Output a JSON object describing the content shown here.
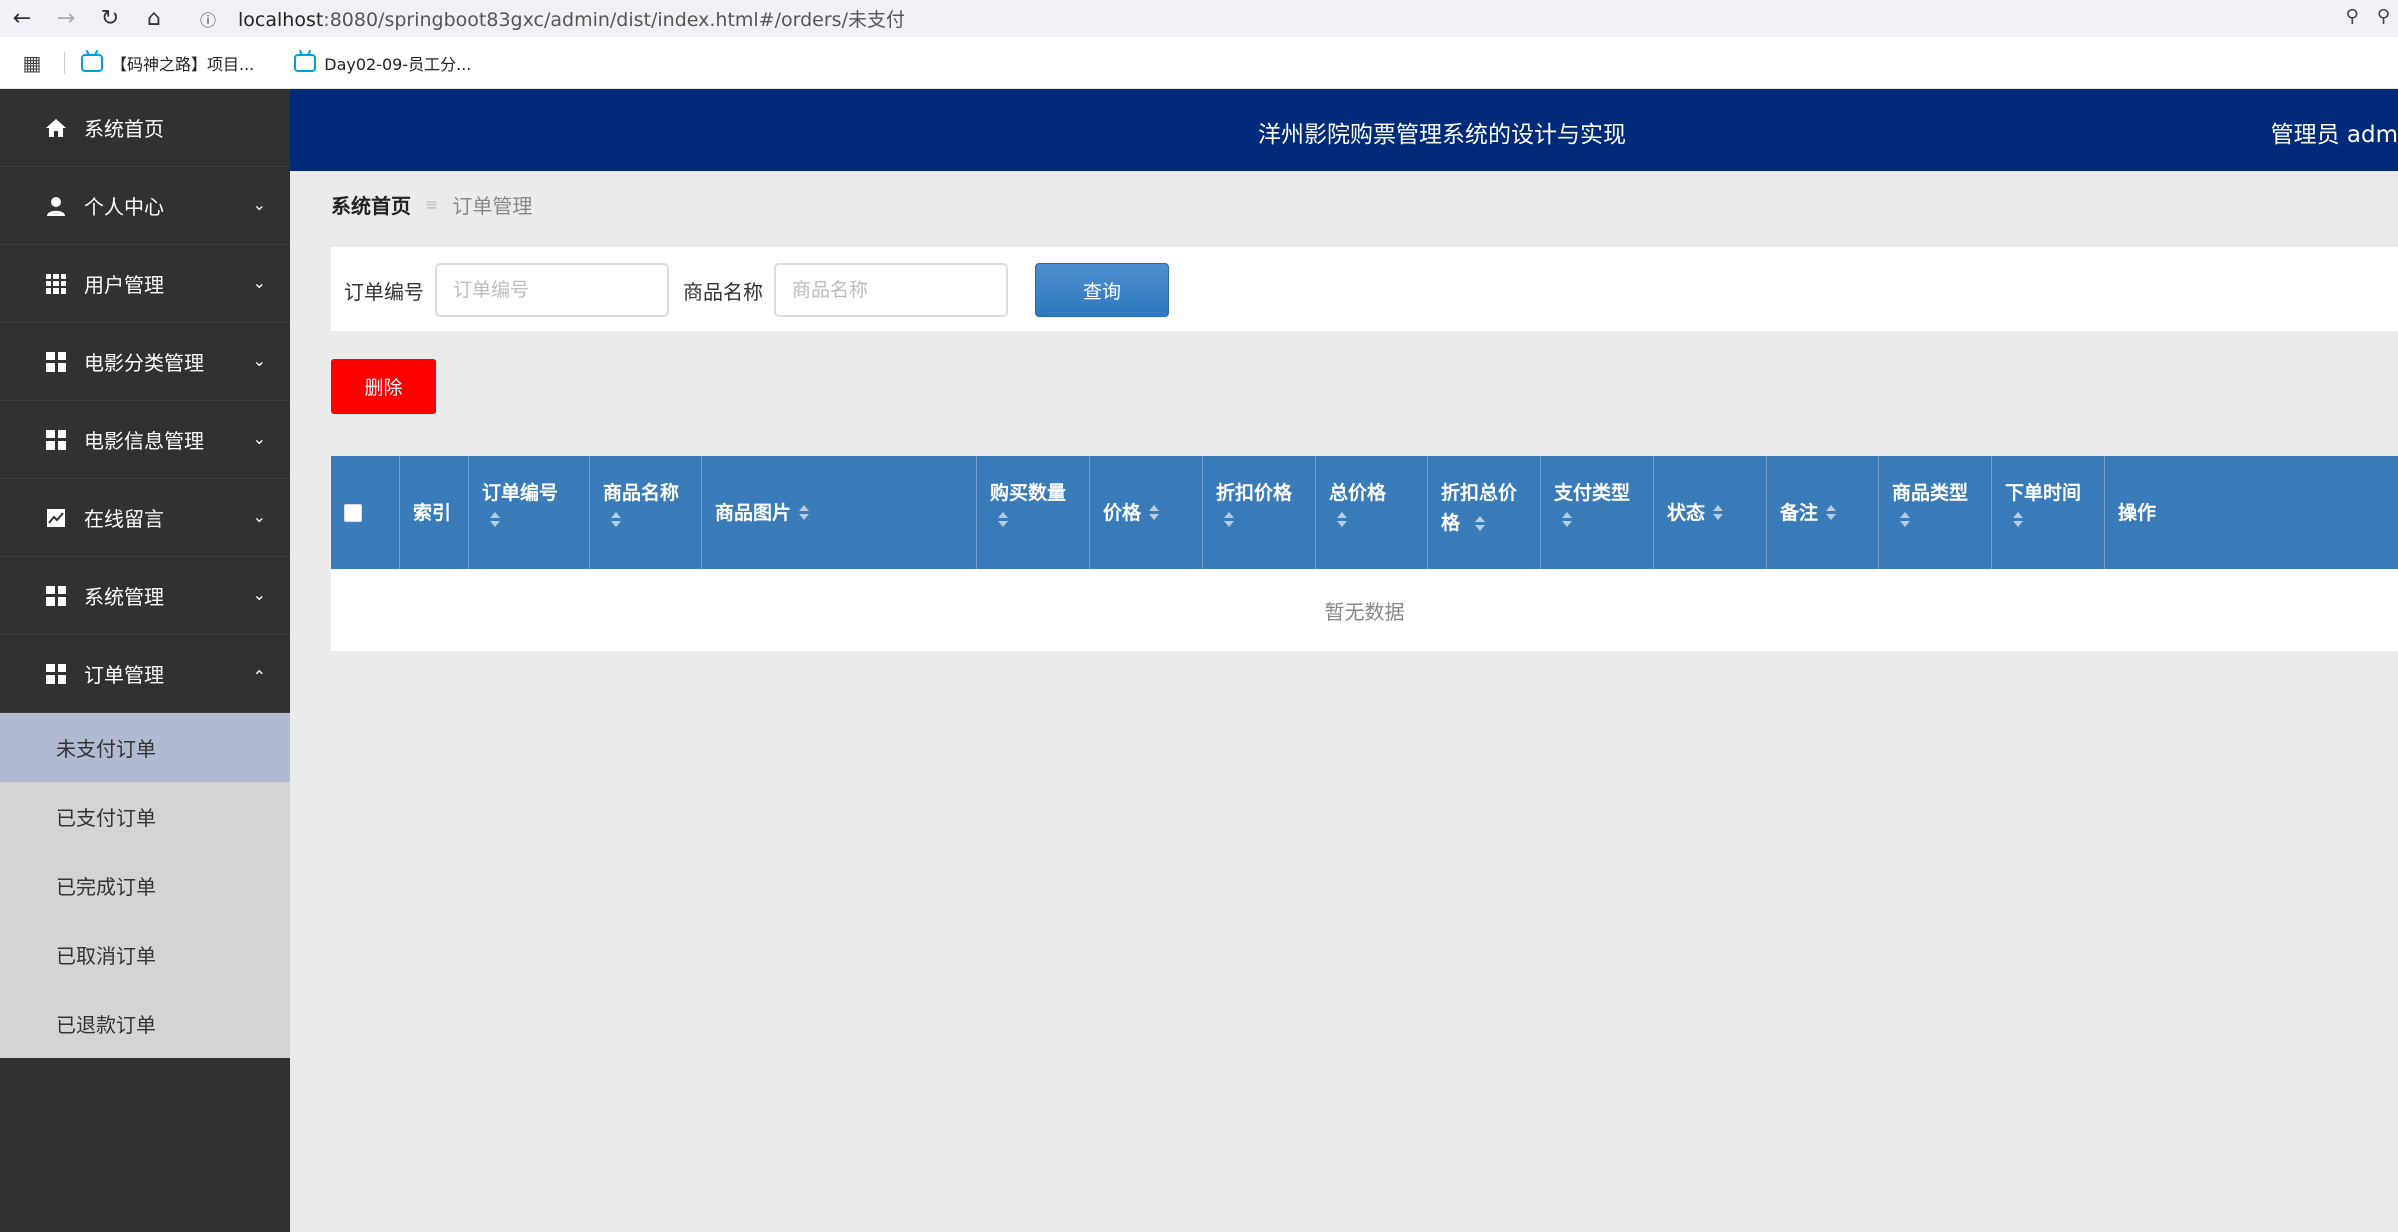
{
  "browser": {
    "url_host": "localhost",
    "url_path": ":8080/springboot83gxc/admin/dist/index.html#/orders/未支付",
    "bookmarks": [
      "【码神之路】项目...",
      "Day02-09-员工分..."
    ]
  },
  "sidebar": {
    "items": [
      {
        "label": "系统首页",
        "icon": "home-icon"
      },
      {
        "label": "个人中心",
        "icon": "user-icon"
      },
      {
        "label": "用户管理",
        "icon": "grid9-icon"
      },
      {
        "label": "电影分类管理",
        "icon": "grid-icon"
      },
      {
        "label": "电影信息管理",
        "icon": "grid-icon"
      },
      {
        "label": "在线留言",
        "icon": "chart-icon"
      },
      {
        "label": "系统管理",
        "icon": "grid-icon"
      },
      {
        "label": "订单管理",
        "icon": "grid-icon"
      }
    ],
    "submenu": [
      "未支付订单",
      "已支付订单",
      "已完成订单",
      "已取消订单",
      "已退款订单"
    ],
    "active_sub": "未支付订单"
  },
  "header": {
    "title": "洋州影院购票管理系统的设计与实现",
    "user": "管理员 adm"
  },
  "breadcrumb": {
    "home": "系统首页",
    "current": "订单管理"
  },
  "search": {
    "order_no_label": "订单编号",
    "order_no_placeholder": "订单编号",
    "goods_name_label": "商品名称",
    "goods_name_placeholder": "商品名称",
    "query_label": "查询"
  },
  "actions": {
    "delete_label": "删除"
  },
  "table": {
    "columns": [
      {
        "line1": "索引",
        "line2": ""
      },
      {
        "line1": "订单编号",
        "line2": ""
      },
      {
        "line1": "商品名称",
        "line2": ""
      },
      {
        "line1": "商品图片",
        "line2": ""
      },
      {
        "line1": "购买数量",
        "line2": ""
      },
      {
        "line1": "价格",
        "line2": ""
      },
      {
        "line1": "折扣价格",
        "line2": ""
      },
      {
        "line1": "总价格",
        "line2": ""
      },
      {
        "line1": "折扣总价",
        "line2": "格"
      },
      {
        "line1": "支付类型",
        "line2": ""
      },
      {
        "line1": "状态",
        "line2": ""
      },
      {
        "line1": "备注",
        "line2": ""
      },
      {
        "line1": "商品类型",
        "line2": ""
      },
      {
        "line1": "下单时间",
        "line2": ""
      },
      {
        "line1": "操作",
        "line2": ""
      }
    ],
    "empty_text": "暂无数据"
  }
}
